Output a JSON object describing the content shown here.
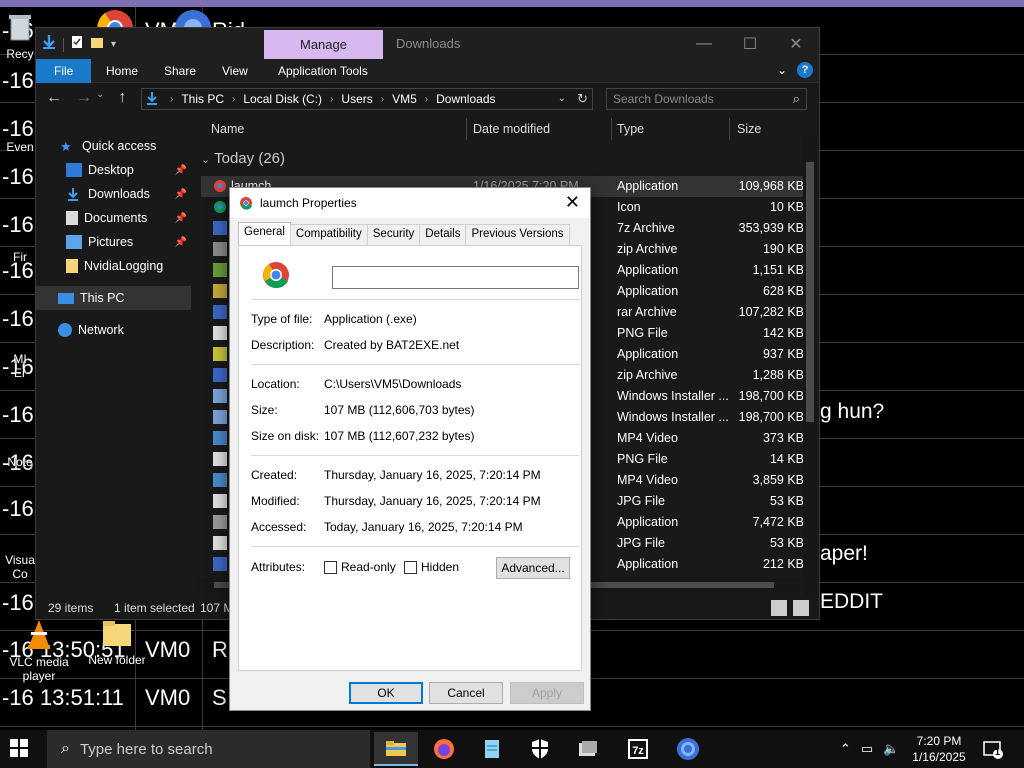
{
  "background": {
    "rows": [
      {
        "time": "-16 ",
        "user": "VM",
        "msg": "Rid",
        "extra": "d"
      },
      {
        "time": "-16",
        "user": "",
        "msg": "",
        "extra": ""
      },
      {
        "time": "-16",
        "user": "",
        "msg": "",
        "extra": ""
      },
      {
        "time": "-16",
        "user": "",
        "msg": "",
        "extra": ""
      },
      {
        "time": "-16",
        "user": "",
        "msg": "",
        "extra": ""
      },
      {
        "time": "-16",
        "user": "",
        "msg": "",
        "extra": ""
      },
      {
        "time": "-16",
        "user": "",
        "msg": "",
        "extra": ""
      },
      {
        "time": "-16",
        "user": "",
        "msg": "",
        "extra": ""
      },
      {
        "time": "-16",
        "user": "",
        "msg": "g hun?",
        "extra": ""
      },
      {
        "time": "-16",
        "user": "",
        "msg": "",
        "extra": ""
      },
      {
        "time": "-16",
        "user": "",
        "msg": "aper!",
        "extra": ""
      },
      {
        "time": "-16",
        "user": "",
        "msg": "EDDIT",
        "extra": ""
      },
      {
        "time": "-16 13:50:51",
        "user": "VM0",
        "msg": "R",
        "extra": ""
      },
      {
        "time": "-16 13:51:11",
        "user": "VM0",
        "msg": "S",
        "extra": ""
      }
    ],
    "desktop_icons": [
      {
        "label": "Recy"
      },
      {
        "label": "Even"
      },
      {
        "label": "Fir"
      },
      {
        "label": "MI"
      },
      {
        "label": "Er"
      },
      {
        "label": "Note"
      },
      {
        "label": "Visua"
      },
      {
        "label": "Co"
      },
      {
        "label": "VLC media player"
      },
      {
        "label": "New folder"
      }
    ]
  },
  "explorer": {
    "manage_tab": "Manage",
    "title": "Downloads",
    "ribbon_tabs": [
      "File",
      "Home",
      "Share",
      "View",
      "Application Tools"
    ],
    "breadcrumbs": [
      "This PC",
      "Local Disk (C:)",
      "Users",
      "VM5",
      "Downloads"
    ],
    "search_placeholder": "Search Downloads",
    "nav": {
      "quick_access": "Quick access",
      "items": [
        "Desktop",
        "Downloads",
        "Documents",
        "Pictures",
        "NvidiaLogging"
      ],
      "this_pc": "This PC",
      "network": "Network"
    },
    "columns": [
      "Name",
      "Date modified",
      "Type",
      "Size"
    ],
    "group": "Today (26)",
    "files": [
      {
        "name": "laumch",
        "date": "1/16/2025 7:20 PM",
        "type": "Application",
        "size": "109,968 KB"
      },
      {
        "name": "",
        "date": "",
        "type": "Icon",
        "size": "10 KB"
      },
      {
        "name": "",
        "date": "",
        "type": "7z Archive",
        "size": "353,939 KB"
      },
      {
        "name": "",
        "date": "",
        "type": "zip Archive",
        "size": "190 KB"
      },
      {
        "name": "",
        "date": "",
        "type": "Application",
        "size": "1,151 KB"
      },
      {
        "name": "",
        "date": "",
        "type": "Application",
        "size": "628 KB"
      },
      {
        "name": "",
        "date": "",
        "type": "rar Archive",
        "size": "107,282 KB"
      },
      {
        "name": "",
        "date": "",
        "type": "PNG File",
        "size": "142 KB"
      },
      {
        "name": "",
        "date": "",
        "type": "Application",
        "size": "937 KB"
      },
      {
        "name": "",
        "date": "",
        "type": "zip Archive",
        "size": "1,288 KB"
      },
      {
        "name": "",
        "date": "",
        "type": "Windows Installer ...",
        "size": "198,700 KB"
      },
      {
        "name": "",
        "date": "",
        "type": "Windows Installer ...",
        "size": "198,700 KB"
      },
      {
        "name": "",
        "date": "",
        "type": "MP4 Video",
        "size": "373 KB"
      },
      {
        "name": "",
        "date": "",
        "type": "PNG File",
        "size": "14 KB"
      },
      {
        "name": "",
        "date": "",
        "type": "MP4 Video",
        "size": "3,859 KB"
      },
      {
        "name": "",
        "date": "",
        "type": "JPG File",
        "size": "53 KB"
      },
      {
        "name": "",
        "date": "",
        "type": "Application",
        "size": "7,472 KB"
      },
      {
        "name": "",
        "date": "",
        "type": "JPG File",
        "size": "53 KB"
      },
      {
        "name": "",
        "date": "",
        "type": "Application",
        "size": "212 KB"
      }
    ],
    "status": {
      "count": "29 items",
      "selected": "1 item selected",
      "size": "107 M"
    }
  },
  "properties": {
    "title": "laumch Properties",
    "tabs": [
      "General",
      "Compatibility",
      "Security",
      "Details",
      "Previous Versions"
    ],
    "name_value": "",
    "fields": {
      "type_label": "Type of file:",
      "type_value": "Application (.exe)",
      "desc_label": "Description:",
      "desc_value": "Created by BAT2EXE.net",
      "loc_label": "Location:",
      "loc_value": "C:\\Users\\VM5\\Downloads",
      "size_label": "Size:",
      "size_value": "107 MB (112,606,703 bytes)",
      "disk_label": "Size on disk:",
      "disk_value": "107 MB (112,607,232 bytes)",
      "created_label": "Created:",
      "created_value": "Thursday, January 16, 2025, 7:20:14 PM",
      "modified_label": "Modified:",
      "modified_value": "Thursday, January 16, 2025, 7:20:14 PM",
      "accessed_label": "Accessed:",
      "accessed_value": "Today, January 16, 2025, 7:20:14 PM",
      "attr_label": "Attributes:",
      "readonly": "Read-only",
      "hidden": "Hidden",
      "advanced": "Advanced..."
    },
    "buttons": {
      "ok": "OK",
      "cancel": "Cancel",
      "apply": "Apply"
    }
  },
  "taskbar": {
    "search_placeholder": "Type here to search",
    "time": "7:20 PM",
    "date": "1/16/2025",
    "notification_count": "1"
  },
  "colors": {
    "accent": "#1979ca",
    "manage_tab": "#d7b9ef",
    "ok_border": "#0078d7"
  }
}
